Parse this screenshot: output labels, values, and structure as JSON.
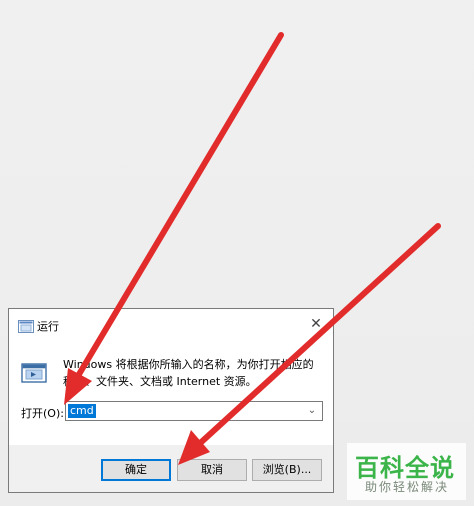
{
  "dialog": {
    "title": "运行",
    "description": "Windows 将根据你所输入的名称，为你打开相应的程序、文件夹、文档或 Internet 资源。",
    "open_label": "打开(O):",
    "open_value": "cmd",
    "buttons": {
      "ok": "确定",
      "cancel": "取消",
      "browse": "浏览(B)..."
    }
  },
  "watermark": {
    "title": "百科全说",
    "subtitle": "助你轻松解决"
  },
  "colors": {
    "accent": "#0078d7",
    "arrow": "#e22b2b",
    "watermark": "#3bb54a"
  },
  "icons": {
    "title_icon": "run-dialog-icon",
    "close_icon": "close-icon",
    "dropdown_icon": "chevron-down-icon"
  }
}
